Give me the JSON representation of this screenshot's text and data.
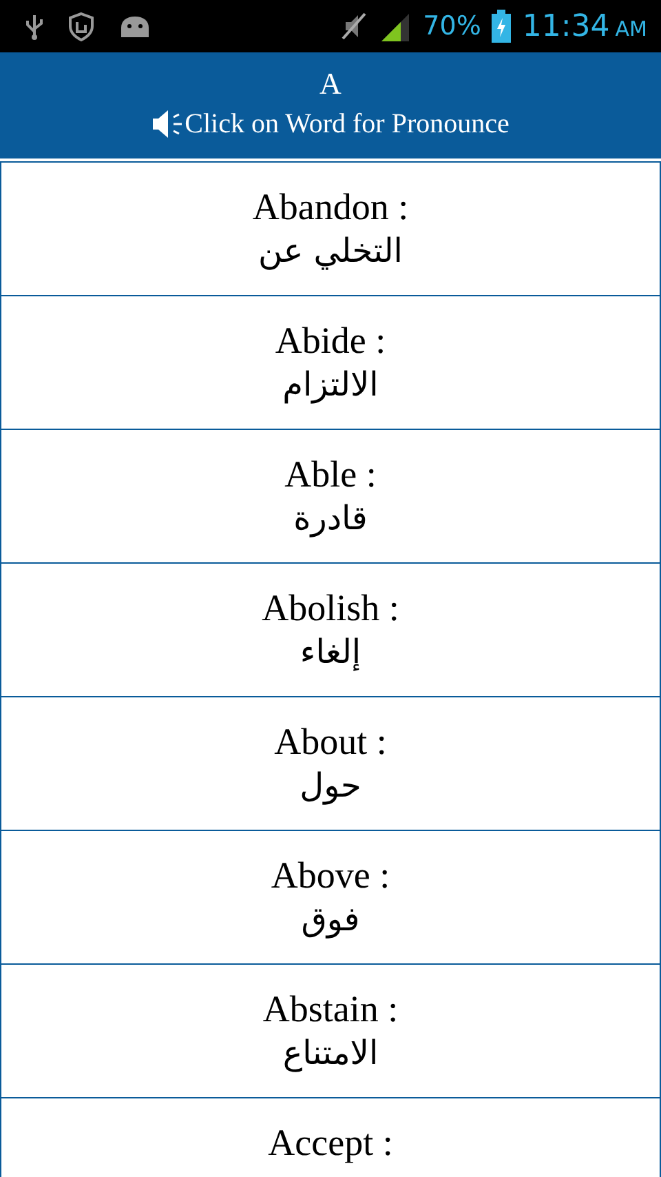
{
  "status_bar": {
    "battery_percent": "70%",
    "time": "11:34",
    "meridiem": "AM"
  },
  "header": {
    "title": "A",
    "hint": "Click on Word for Pronounce"
  },
  "words": [
    {
      "word": "Abandon :",
      "translation": "التخلي عن"
    },
    {
      "word": "Abide :",
      "translation": "الالتزام"
    },
    {
      "word": "Able :",
      "translation": "قادرة"
    },
    {
      "word": "Abolish :",
      "translation": "إلغاء"
    },
    {
      "word": "About :",
      "translation": "حول"
    },
    {
      "word": "Above :",
      "translation": "فوق"
    },
    {
      "word": "Abstain :",
      "translation": "الامتناع"
    },
    {
      "word": "Accept :"
    }
  ]
}
